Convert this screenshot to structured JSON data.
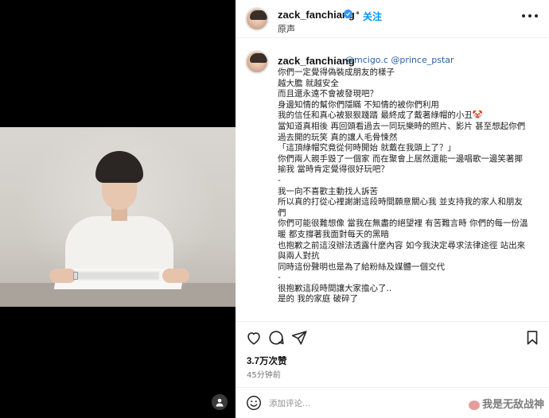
{
  "header": {
    "username": "zack_fanchiang",
    "separator": "•",
    "follow_label": "关注",
    "subtitle": "原声"
  },
  "caption": {
    "username": "zack_fanchiang",
    "mentions": "@mcigo.c @prince_pstar",
    "lines": [
      "你們一定覺得偽裝成朋友的樣子",
      "越大膽 就越安全",
      "而且還永遠不會被發現吧？",
      "身邊知情的幫你們隱瞞 不知情的被你們利用",
      "我的信任和真心被狠狠踐踏 最終成了戴著綠帽的小丑🤡",
      "當知道真相後 再回頭看過去一同玩樂時的照片、影片 甚至想起你們",
      "過去開的玩笑 真的讓人毛骨悚然",
      "「這頂綠帽究竟從何時開始 就戴在我頭上了？」",
      "你們兩人親手毀了一個家 而在聚會上居然還能一邊唱歌一邊笑著揶",
      "揄我 當時肯定覺得很好玩吧？",
      "-",
      "我一向不喜歡主動找人訴苦",
      "所以真的打從心裡謝謝這段時間願意關心我 並支持我的家人和朋友",
      "們",
      "你們可能很難想像 當我在無盡的絕望裡 有苦難言時 你們的每一份溫",
      "暖 都支撐著我面對每天的黑暗",
      "也抱歉之前這沒辦法透露什麼內容 如今我決定尋求法律途徑 站出來",
      "與兩人對抗",
      "同時這份聲明也是為了給粉絲及媒體一個交代",
      "-",
      "很抱歉這段時間讓大家擔心了..",
      "是的 我的家庭 破碎了"
    ]
  },
  "stats": {
    "likes": "3.7万次赞",
    "time": "45分钟前"
  },
  "comment": {
    "placeholder": "添加评论..."
  },
  "watermark": {
    "text": "我是无敌战神"
  },
  "icons": {
    "like": "heart-icon",
    "comment": "comment-icon",
    "share": "send-icon",
    "save": "bookmark-icon",
    "more": "more-icon",
    "emoji": "emoji-icon",
    "verified": "verified-icon",
    "video_user": "user-icon"
  },
  "colors": {
    "link": "#0095f6",
    "verified": "#3897f0",
    "mention": "#2a5fa3"
  }
}
